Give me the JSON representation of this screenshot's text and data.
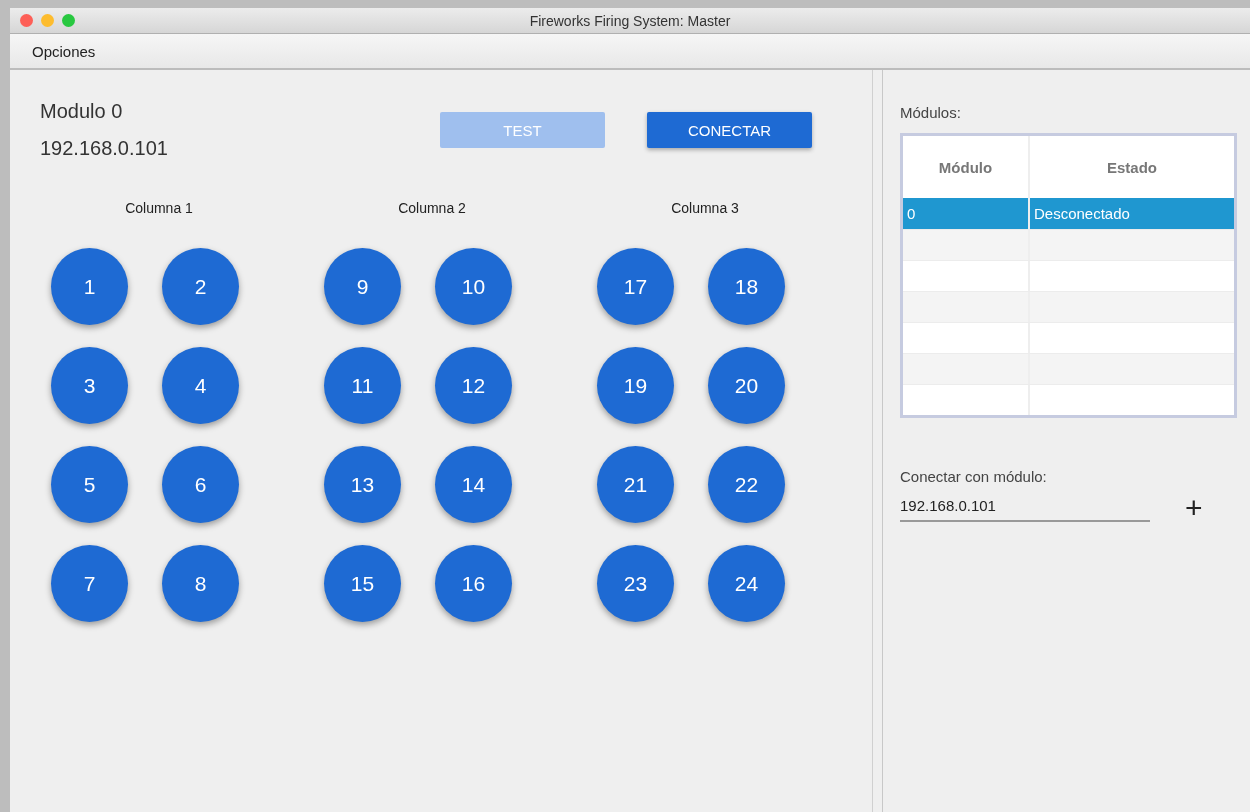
{
  "window": {
    "title": "Fireworks Firing System: Master"
  },
  "menu": [
    "Opciones"
  ],
  "module": {
    "name": "Modulo 0",
    "address": "192.168.0.101"
  },
  "actions": [
    {
      "label": "TEST",
      "disabled": true
    },
    {
      "label": "CONECTAR",
      "disabled": false
    }
  ],
  "columns": [
    {
      "title": "Columna 1",
      "buttons": [
        "1",
        "2",
        "3",
        "4",
        "5",
        "6",
        "7",
        "8"
      ]
    },
    {
      "title": "Columna 2",
      "buttons": [
        "9",
        "10",
        "11",
        "12",
        "13",
        "14",
        "15",
        "16"
      ]
    },
    {
      "title": "Columna 3",
      "buttons": [
        "17",
        "18",
        "19",
        "20",
        "21",
        "22",
        "23",
        "24"
      ]
    }
  ],
  "modules_panel": {
    "label": "Módulos:",
    "table": {
      "columns": [
        "Módulo",
        "Estado"
      ],
      "rows": [
        {
          "cells": [
            "0",
            "Desconectado"
          ],
          "selected": true
        }
      ]
    }
  },
  "connect": {
    "label": "Conectar con módulo:",
    "value": "192.168.0.101",
    "add_button": "+"
  }
}
